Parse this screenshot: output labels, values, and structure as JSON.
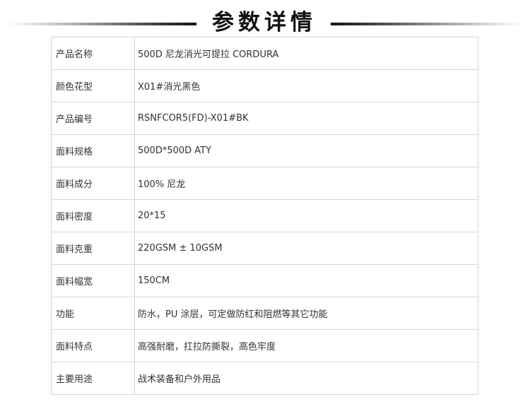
{
  "header": {
    "title": "参数详情"
  },
  "spec_rows": [
    {
      "label": "产品名称",
      "value": "500D 尼龙消光可提拉 CORDURA"
    },
    {
      "label": "颜色花型",
      "value": "X01#消光黑色"
    },
    {
      "label": "产品编号",
      "value": "RSNFCOR5(FD)-X01#BK"
    },
    {
      "label": "面料规格",
      "value": "500D*500D ATY"
    },
    {
      "label": "面料成分",
      "value": "100%  尼龙"
    },
    {
      "label": "面料密度",
      "value": "20*15"
    },
    {
      "label": "面料克重",
      "value": "220GSM ± 10GSM"
    },
    {
      "label": "面料幅宽",
      "value": "150CM"
    },
    {
      "label": "功能",
      "value": "防水，PU 涂层，可定做防红和阻燃等其它功能"
    },
    {
      "label": "面料特点",
      "value": "高强耐磨，扛拉防撕裂，高色牢度"
    },
    {
      "label": "主要用途",
      "value": "战术装备和户外用品"
    }
  ]
}
